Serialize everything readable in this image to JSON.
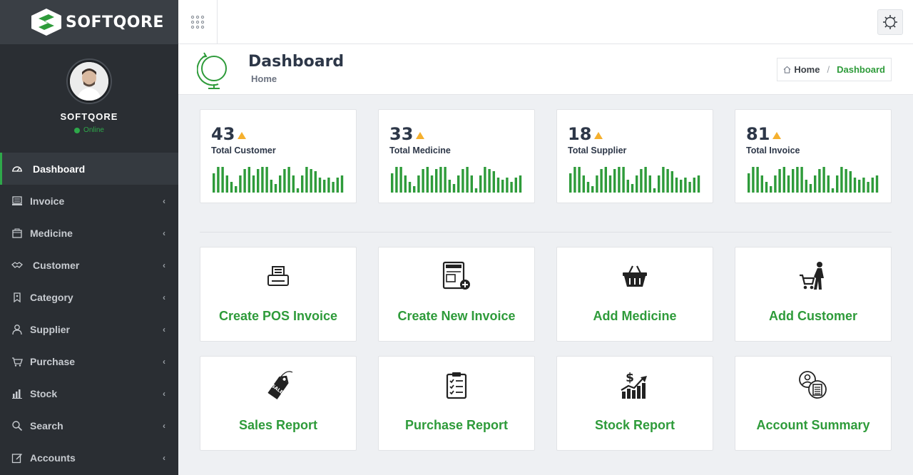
{
  "brand": {
    "name": "SOFTQORE",
    "accent": "#2e9b3a"
  },
  "profile": {
    "name": "SOFTQORE",
    "status": "Online"
  },
  "sidebar": {
    "items": [
      {
        "label": "Dashboard",
        "icon": "dashboard-gauge-icon",
        "active": true
      },
      {
        "label": "Invoice",
        "icon": "invoice-icon"
      },
      {
        "label": "Medicine",
        "icon": "medicine-box-icon"
      },
      {
        "label": "Customer",
        "icon": "handshake-icon"
      },
      {
        "label": "Category",
        "icon": "tag-icon"
      },
      {
        "label": "Supplier",
        "icon": "user-icon"
      },
      {
        "label": "Purchase",
        "icon": "cart-icon"
      },
      {
        "label": "Stock",
        "icon": "bar-chart-icon"
      },
      {
        "label": "Search",
        "icon": "search-icon"
      },
      {
        "label": "Accounts",
        "icon": "edit-icon"
      }
    ]
  },
  "header": {
    "title": "Dashboard",
    "subtitle": "Home",
    "breadcrumb": {
      "home": "Home",
      "current": "Dashboard"
    }
  },
  "stats": [
    {
      "value": "43",
      "label": "Total Customer"
    },
    {
      "value": "33",
      "label": "Total Medicine"
    },
    {
      "value": "18",
      "label": "Total Supplier"
    },
    {
      "value": "81",
      "label": "Total Invoice"
    }
  ],
  "sparkline": [
    9,
    12,
    12,
    8,
    5,
    3,
    8,
    11,
    12,
    8,
    11,
    12,
    12,
    6,
    4,
    8,
    11,
    12,
    8,
    2,
    8,
    12,
    11,
    10,
    7,
    6,
    7,
    5,
    7,
    8
  ],
  "tiles": [
    {
      "label": "Create POS Invoice",
      "icon": "pos-terminal-icon"
    },
    {
      "label": "Create New Invoice",
      "icon": "invoice-add-icon"
    },
    {
      "label": "Add Medicine",
      "icon": "basket-icon"
    },
    {
      "label": "Add Customer",
      "icon": "shopper-cart-icon"
    },
    {
      "label": "Sales Report",
      "icon": "sale-tag-icon"
    },
    {
      "label": "Purchase Report",
      "icon": "clipboard-checklist-icon"
    },
    {
      "label": "Stock Report",
      "icon": "stock-growth-icon"
    },
    {
      "label": "Account Summary",
      "icon": "account-document-icon"
    }
  ]
}
